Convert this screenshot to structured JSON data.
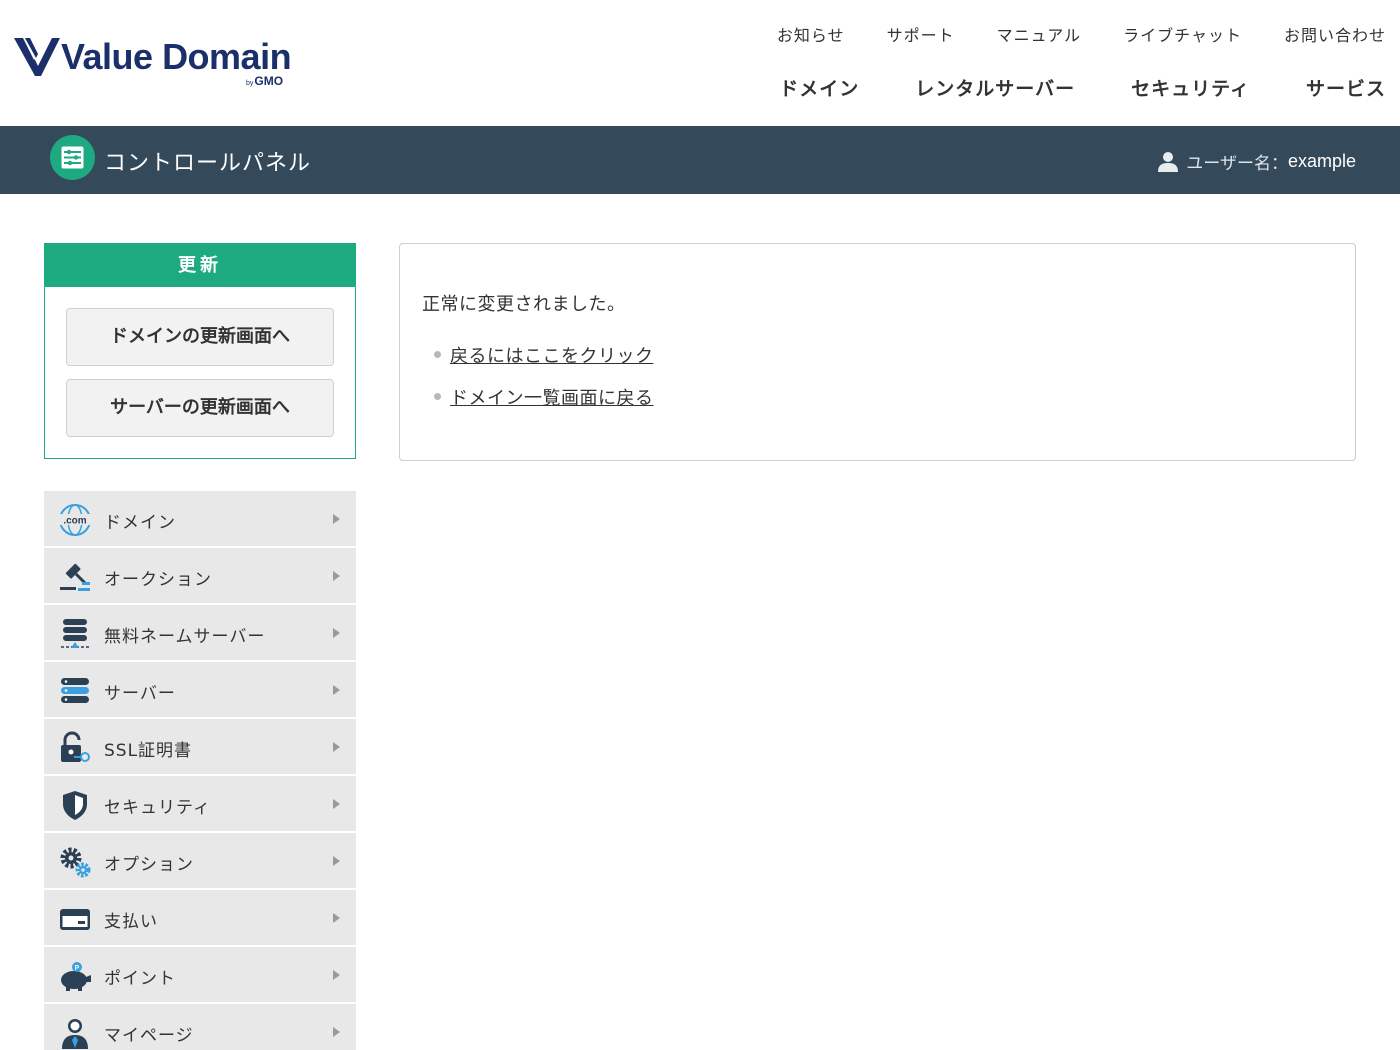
{
  "header": {
    "logo_text": "Value Domain",
    "logo_sub_by": "by",
    "logo_sub_brand": "GMO",
    "subnav": [
      "お知らせ",
      "サポート",
      "マニュアル",
      "ライブチャット",
      "お問い合わせ"
    ],
    "mainnav": [
      "ドメイン",
      "レンタルサーバー",
      "セキュリティ",
      "サービス"
    ]
  },
  "cpbar": {
    "title": "コントロールパネル",
    "user_label": "ユーザー名：",
    "username": "example"
  },
  "renew": {
    "heading": "更新",
    "buttons": [
      "ドメインの更新画面へ",
      "サーバーの更新画面へ"
    ]
  },
  "sidemenu": {
    "items": [
      {
        "label": "ドメイン",
        "icon": "globe-com-icon"
      },
      {
        "label": "オークション",
        "icon": "gavel-icon"
      },
      {
        "label": "無料ネームサーバー",
        "icon": "nameserver-icon"
      },
      {
        "label": "サーバー",
        "icon": "server-icon"
      },
      {
        "label": "SSL証明書",
        "icon": "ssl-lock-icon"
      },
      {
        "label": "セキュリティ",
        "icon": "shield-icon"
      },
      {
        "label": "オプション",
        "icon": "gears-icon"
      },
      {
        "label": "支払い",
        "icon": "credit-card-icon"
      },
      {
        "label": "ポイント",
        "icon": "piggy-bank-icon"
      },
      {
        "label": "マイページ",
        "icon": "user-icon"
      }
    ]
  },
  "main": {
    "message": "正常に変更されました。",
    "links": [
      "戻るにはここをクリック",
      "ドメイン一覧画面に戻る"
    ]
  },
  "colors": {
    "accent_green": "#1daa80",
    "bar_dark": "#34495a",
    "logo_navy": "#1b2f6b",
    "icon_navy": "#2b3f55",
    "icon_blue": "#3aa0e0"
  }
}
